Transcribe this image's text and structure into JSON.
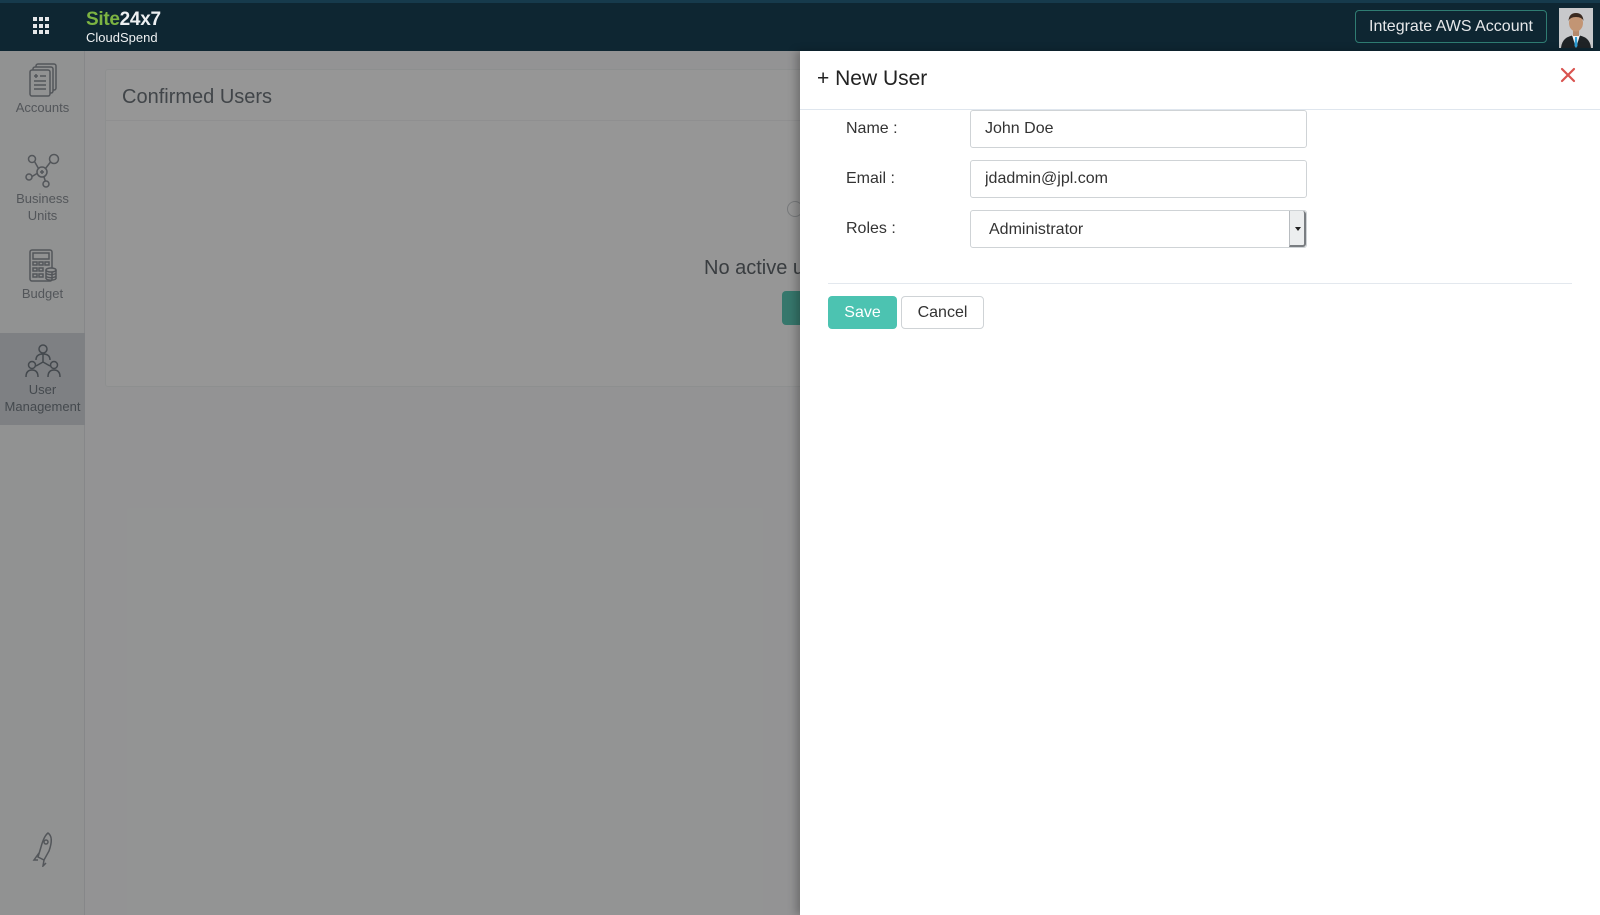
{
  "header": {
    "apps_icon": "grid-apps-icon",
    "brand_part1": "Site",
    "brand_part2": "24x7",
    "product": "CloudSpend",
    "integrate_button": "Integrate AWS Account",
    "avatar_icon": "user-avatar"
  },
  "sidebar": {
    "items": [
      {
        "label": "Accounts",
        "icon": "documents-icon",
        "active": false
      },
      {
        "label": "Business Units",
        "label_line1": "Business",
        "label_line2": "Units",
        "icon": "network-nodes-icon",
        "active": false
      },
      {
        "label": "Budget",
        "icon": "calculator-icon",
        "active": false
      },
      {
        "label": "User Management",
        "label_line1": "User",
        "label_line2": "Management",
        "icon": "user-hierarchy-icon",
        "active": true
      }
    ],
    "bottom_icon": "rocket-icon"
  },
  "main": {
    "card_title": "Confirmed Users",
    "empty_message": "No active u"
  },
  "panel": {
    "title": "+ New User",
    "close_icon": "close-x-icon",
    "fields": {
      "name_label": "Name :",
      "name_value": "John Doe",
      "email_label": "Email :",
      "email_value": "jdadmin@jpl.com",
      "roles_label": "Roles :",
      "roles_value": "Administrator"
    },
    "save_label": "Save",
    "cancel_label": "Cancel"
  },
  "colors": {
    "header_bg": "#0e2632",
    "brand_green": "#7cb342",
    "accent_teal": "#4cc3b1",
    "close_red": "#d9534f"
  }
}
